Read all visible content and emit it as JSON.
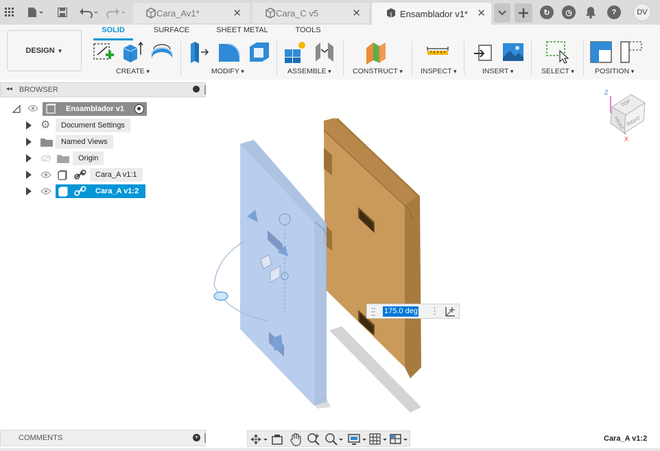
{
  "topbar": {
    "tabs": [
      {
        "label": "Cara_Av1*",
        "active": false
      },
      {
        "label": "Cara_C v5",
        "active": false
      },
      {
        "label": "Ensamblador v1*",
        "active": true
      }
    ],
    "user_initials": "DV",
    "icons": [
      "grid-menu-icon",
      "file-icon",
      "save-icon",
      "undo-icon",
      "redo-icon",
      "tab-overflow-icon",
      "new-tab-icon",
      "extensions-icon",
      "job-status-icon",
      "notifications-icon",
      "help-icon"
    ]
  },
  "toolbar": {
    "workspace": "DESIGN",
    "tabs": [
      "SOLID",
      "SURFACE",
      "SHEET METAL",
      "TOOLS"
    ],
    "active_tab": "SOLID",
    "groups": [
      "CREATE",
      "MODIFY",
      "ASSEMBLE",
      "CONSTRUCT",
      "INSPECT",
      "INSERT",
      "SELECT",
      "POSITION"
    ],
    "accent_color": "#0696d7"
  },
  "browser": {
    "title": "BROWSER",
    "root": "Ensamblador v1",
    "items": [
      {
        "label": "Document Settings",
        "icon": "gear-icon",
        "selected": false
      },
      {
        "label": "Named Views",
        "icon": "folder-icon",
        "selected": false
      },
      {
        "label": "Origin",
        "icon": "folder-icon",
        "selected": false
      },
      {
        "label": "Cara_A v1:1",
        "icon": "component-link-icon",
        "selected": false
      },
      {
        "label": "Cara_A v1:2",
        "icon": "component-link-icon",
        "selected": true
      }
    ]
  },
  "viewcube": {
    "faces": [
      "TOP",
      "FRONT",
      "RIGHT"
    ],
    "axes": [
      "Z",
      "X"
    ]
  },
  "manipulator": {
    "angle_value": "175.0 deg"
  },
  "comments": {
    "label": "COMMENTS"
  },
  "status": {
    "selection": "Cara_A v1:2"
  }
}
